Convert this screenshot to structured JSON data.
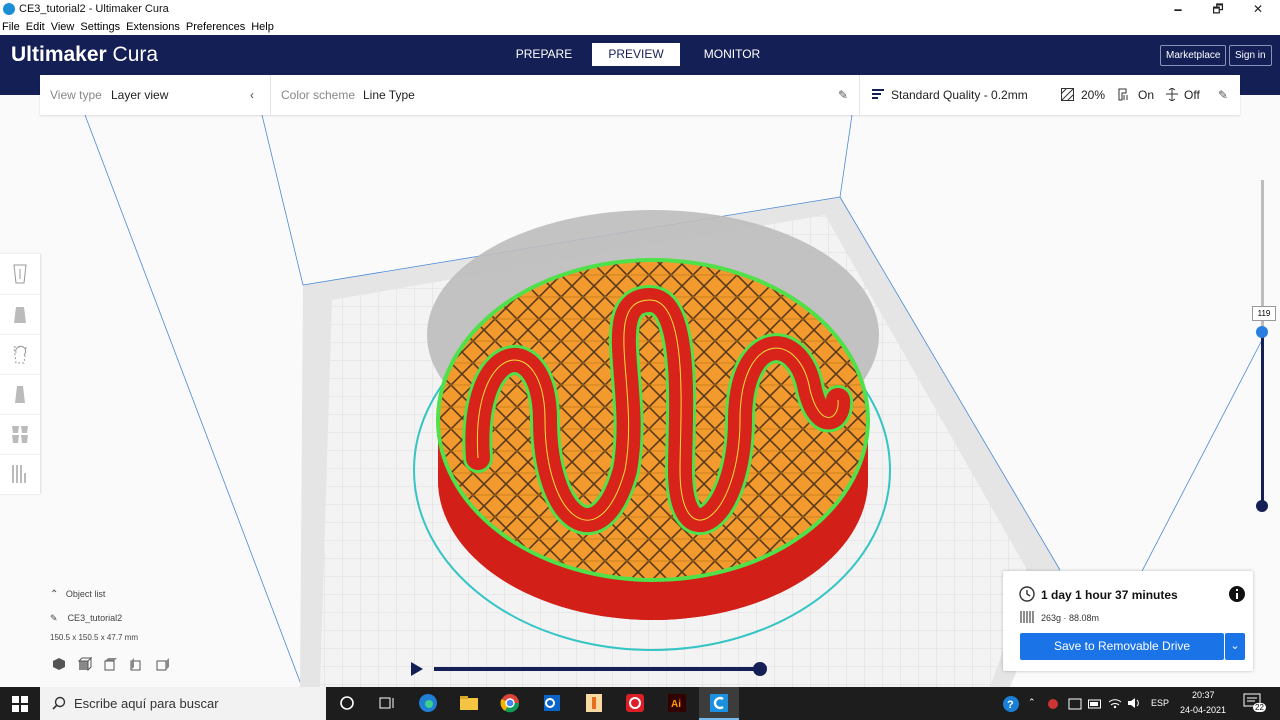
{
  "window": {
    "title": "CE3_tutorial2 - Ultimaker Cura",
    "minimize": "🗕",
    "maximize": "🗗",
    "close": "✕"
  },
  "menu": [
    "File",
    "Edit",
    "View",
    "Settings",
    "Extensions",
    "Preferences",
    "Help"
  ],
  "header": {
    "logo_bold": "Ultimaker",
    "logo_light": " Cura",
    "tabs": [
      "PREPARE",
      "PREVIEW",
      "MONITOR"
    ],
    "active_tab": "PREVIEW",
    "marketplace": "Marketplace",
    "signin": "Sign in"
  },
  "toolbar": {
    "view_type_label": "View type",
    "view_type_value": "Layer view",
    "color_scheme_label": "Color scheme",
    "color_scheme_value": "Line Type",
    "quality": "Standard Quality - 0.2mm",
    "infill": "20%",
    "support": "On",
    "adhesion": "Off"
  },
  "layer_slider": {
    "current_layer": "119",
    "fraction": 0.53
  },
  "object_list": {
    "toggle": "Object list",
    "name": "CE3_tutorial2",
    "dimensions": "150.5 x 150.5 x 47.7 mm"
  },
  "print_info": {
    "time": "1 day 1 hour 37 minutes",
    "material": "263g · 88.08m",
    "save_label": "Save to Removable Drive"
  },
  "taskbar": {
    "search_placeholder": "Escribe aquí para buscar",
    "lang": "ESP",
    "time": "20:37",
    "date": "24-04-2021",
    "notifications": "22"
  },
  "colors": {
    "header_bg": "#141f55",
    "accent_blue": "#1b73e8",
    "slider_handle": "#2a7de1",
    "model_red": "#e5231b",
    "infill_orange": "#f29a2e",
    "skin_green": "#4fe04a"
  }
}
